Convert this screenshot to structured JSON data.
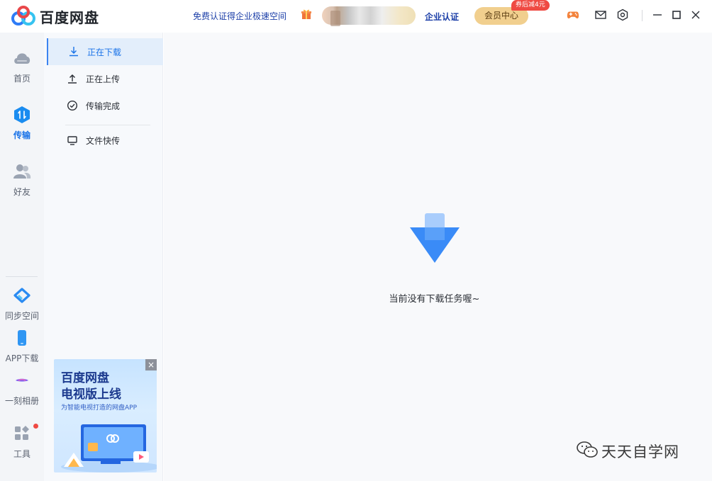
{
  "app": {
    "title": "百度网盘"
  },
  "header": {
    "promo_text": "免费认证得企业极速空间",
    "enterprise_label": "企业认证",
    "vip_label": "会员中心",
    "vip_badge": "券后减4元",
    "icons": [
      "gift-icon",
      "game-icon",
      "mail-icon",
      "settings-icon",
      "minimize-icon",
      "maximize-icon",
      "close-icon"
    ]
  },
  "sidebar": {
    "items": [
      {
        "label": "首页",
        "icon": "cloud-icon"
      },
      {
        "label": "传输",
        "icon": "transfer-icon",
        "active": true
      },
      {
        "label": "好友",
        "icon": "friends-icon"
      },
      {
        "label": "同步空间",
        "icon": "sync-icon"
      },
      {
        "label": "APP下载",
        "icon": "phone-icon"
      },
      {
        "label": "一刻相册",
        "icon": "album-icon"
      },
      {
        "label": "工具",
        "icon": "tools-icon"
      }
    ]
  },
  "subnav": {
    "items": [
      {
        "label": "正在下载",
        "icon": "download-icon",
        "active": true
      },
      {
        "label": "正在上传",
        "icon": "upload-icon"
      },
      {
        "label": "传输完成",
        "icon": "check-circle-icon"
      },
      {
        "label": "文件快传",
        "icon": "monitor-icon"
      }
    ]
  },
  "ad": {
    "title1": "百度网盘",
    "title2": "电视版上线",
    "subtitle": "为智能电视打造的网盘APP",
    "close": "×"
  },
  "main": {
    "empty_text": "当前没有下载任务喔~"
  },
  "watermark": {
    "text": "天天自学网"
  },
  "colors": {
    "accent": "#1a73e8",
    "vip_gold": "#f1cf8e",
    "badge_red": "#ef4a43",
    "link_blue": "#1c3fa8"
  }
}
